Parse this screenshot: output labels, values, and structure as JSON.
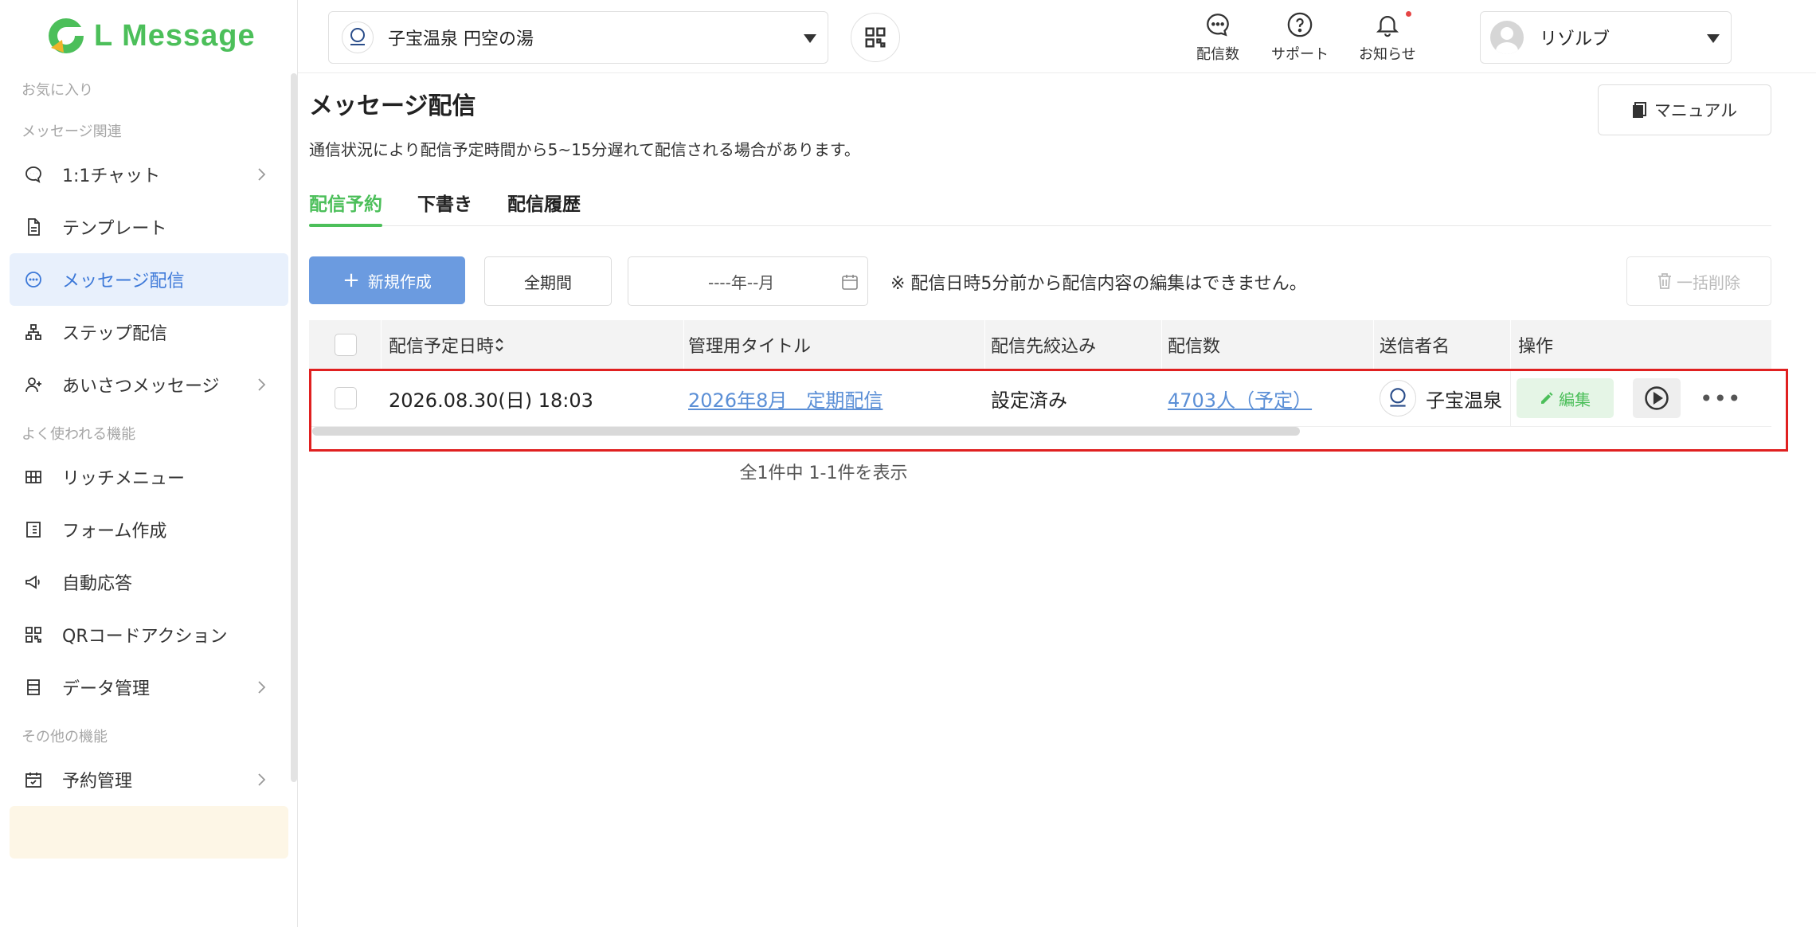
{
  "app": {
    "logo_text": "L Message",
    "brand_color": "#4cbf5a",
    "accent_color": "#3c78d8"
  },
  "sidebar": {
    "sections": [
      {
        "title": "お気に入り",
        "items": []
      },
      {
        "title": "メッセージ関連",
        "items": [
          {
            "label": "1:1チャット",
            "icon": "chat-icon",
            "chevron": true
          },
          {
            "label": "テンプレート",
            "icon": "document-icon",
            "chevron": false
          },
          {
            "label": "メッセージ配信",
            "icon": "message-icon",
            "chevron": false,
            "active": true
          },
          {
            "label": "ステップ配信",
            "icon": "step-icon",
            "chevron": false
          },
          {
            "label": "あいさつメッセージ",
            "icon": "user-plus-icon",
            "chevron": true
          }
        ]
      },
      {
        "title": "よく使われる機能",
        "items": [
          {
            "label": "リッチメニュー",
            "icon": "grid-icon",
            "chevron": false
          },
          {
            "label": "フォーム作成",
            "icon": "form-icon",
            "chevron": false
          },
          {
            "label": "自動応答",
            "icon": "megaphone-icon",
            "chevron": false
          },
          {
            "label": "QRコードアクション",
            "icon": "qr-icon",
            "chevron": false
          },
          {
            "label": "データ管理",
            "icon": "database-icon",
            "chevron": true
          }
        ]
      },
      {
        "title": "その他の機能",
        "items": [
          {
            "label": "予約管理",
            "icon": "calendar-icon",
            "chevron": true
          }
        ]
      }
    ]
  },
  "topbar": {
    "account_name": "子宝温泉 円空の湯",
    "icons": [
      {
        "label": "配信数",
        "icon": "chat-bubble-icon"
      },
      {
        "label": "サポート",
        "icon": "help-icon"
      },
      {
        "label": "お知らせ",
        "icon": "bell-icon"
      }
    ],
    "user_name": "リゾルブ"
  },
  "main": {
    "title": "メッセージ配信",
    "subtitle": "通信状況により配信予定時間から5~15分遅れて配信される場合があります。",
    "manual_label": "マニュアル",
    "tabs": [
      {
        "label": "配信予約",
        "active": true
      },
      {
        "label": "下書き",
        "active": false
      },
      {
        "label": "配信履歴",
        "active": false
      }
    ],
    "toolbar": {
      "new_label": "新規作成",
      "period_label": "全期間",
      "month_placeholder": "----年--月",
      "note": "※ 配信日時5分前から配信内容の編集はできません。",
      "bulk_delete_label": "一括削除"
    },
    "table": {
      "headers": [
        "配信予定日時",
        "管理用タイトル",
        "配信先絞込み",
        "配信数",
        "送信者名",
        "操作"
      ],
      "rows": [
        {
          "datetime": "2026.08.30(日) 18:03",
          "title": "2026年8月　定期配信",
          "filter": "設定済み",
          "count": "4703人（予定）",
          "sender": "子宝温泉",
          "edit_label": "編集"
        }
      ]
    },
    "pager": "全1件中 1-1件を表示"
  }
}
